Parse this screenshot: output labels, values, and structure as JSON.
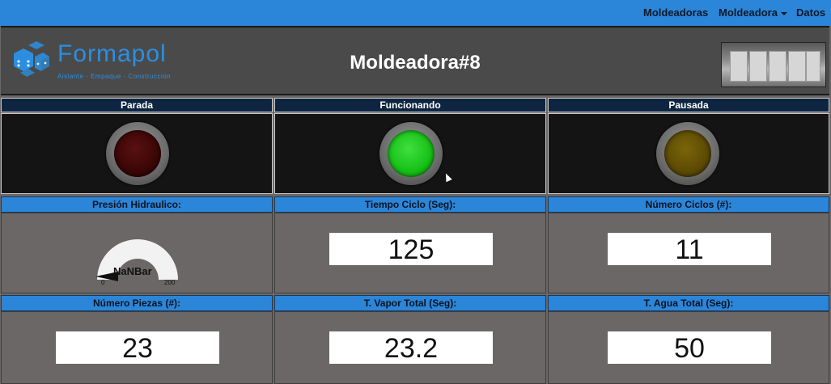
{
  "nav": {
    "items": [
      "Moldeadoras",
      "Moldeadora",
      "Datos"
    ]
  },
  "header": {
    "logo_name": "Formapol",
    "logo_tagline": "Aislante - Empaque - Construcción",
    "title": "Moldeadora#8"
  },
  "status": [
    {
      "label": "Parada",
      "color": "#3a0606"
    },
    {
      "label": "Funcionando",
      "color": "#16c016"
    },
    {
      "label": "Pausada",
      "color": "#5c4a05"
    }
  ],
  "metrics_row1": [
    {
      "label": "Presión Hidraulico:",
      "gauge": {
        "value": "NaNBar",
        "min": "0",
        "max": "200"
      }
    },
    {
      "label": "Tiempo Ciclo (Seg):",
      "value": "125"
    },
    {
      "label": "Número Ciclos (#):",
      "value": "11"
    }
  ],
  "metrics_row2": [
    {
      "label": "Número Piezas (#):",
      "value": "23"
    },
    {
      "label": "T. Vapor Total (Seg):",
      "value": "23.2"
    },
    {
      "label": "T. Agua Total (Seg):",
      "value": "50"
    }
  ],
  "colors": {
    "navbar": "#2b85d8",
    "brand": "#2b8fe0",
    "label_dark": "#0d2540",
    "panel_dark": "#141414",
    "panel_gray": "#6c6767"
  }
}
